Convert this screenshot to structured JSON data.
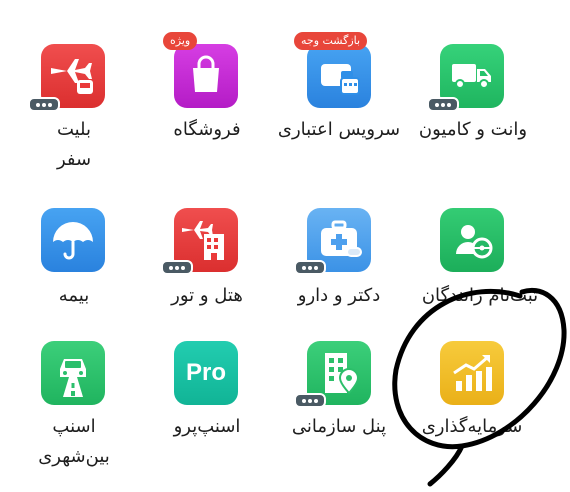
{
  "apps": [
    {
      "id": "van",
      "label": "وانت و کامیون",
      "icon": "truck-icon",
      "color": "#25c26a",
      "has_menu": true
    },
    {
      "id": "credit",
      "label": "سرویس اعتباری",
      "icon": "wallet-calendar-icon",
      "color": "#2f8fe8",
      "badge": "بازگشت وجه"
    },
    {
      "id": "store",
      "label": "فروشگاه",
      "icon": "shopping-bag-icon",
      "color": "#c626d6",
      "badge": "ویژه"
    },
    {
      "id": "ticket",
      "label_lines": [
        "بلیت",
        "سفر"
      ],
      "icon": "plane-bus-icon",
      "color": "#ea3a3a",
      "has_menu": true
    },
    {
      "id": "driver",
      "label": "ثبت‌نام رانندگان",
      "icon": "driver-steering-icon",
      "color": "#24b865"
    },
    {
      "id": "doctor",
      "label": "دکتر و دارو",
      "icon": "medical-kit-icon",
      "color": "#4ea0ee",
      "has_menu": true
    },
    {
      "id": "hotel",
      "label": "هتل و تور",
      "icon": "hotel-plane-icon",
      "color": "#ea3a3a",
      "has_menu": true
    },
    {
      "id": "insurance",
      "label": "بیمه",
      "icon": "umbrella-icon",
      "color": "#2f8fe8"
    },
    {
      "id": "invest",
      "label": "سرمایه‌گذاری",
      "icon": "chart-arrow-icon",
      "color": "#f2bd24"
    },
    {
      "id": "org",
      "label": "پنل سازمانی",
      "icon": "building-pin-icon",
      "color": "#2cbf6a",
      "has_menu": true
    },
    {
      "id": "pro",
      "label": "اسنپ‌پرو",
      "icon": "pro-icon",
      "icon_text": "Pro",
      "color": "#16c0a2"
    },
    {
      "id": "intercity",
      "label_lines": [
        "اسنپ",
        "بین‌شهری"
      ],
      "icon": "car-road-icon",
      "color": "#2bbf6c"
    }
  ],
  "colors": {
    "text": "#1e1e1e",
    "badge": "#e8463a",
    "menu_badge": "#4a5a64",
    "annotation": "#000000"
  }
}
